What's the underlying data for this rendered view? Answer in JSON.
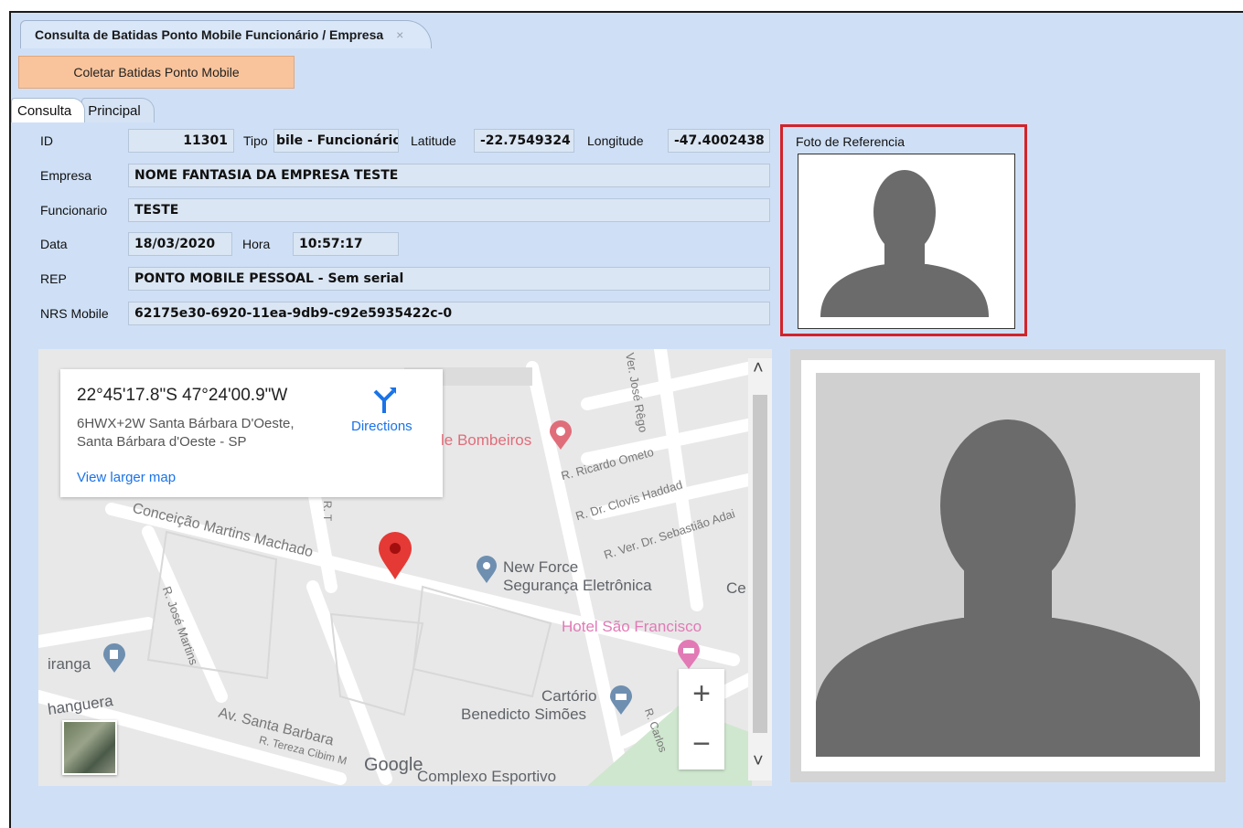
{
  "window": {
    "doc_tab": "Consulta de Batidas Ponto Mobile Funcionário / Empresa",
    "doc_tab_close": "×",
    "toolbar_button": "Coletar Batidas Ponto Mobile",
    "accent_color": "#f9c49c"
  },
  "tabs": [
    {
      "label": "Consulta",
      "active": true
    },
    {
      "label": "Principal",
      "active": false
    }
  ],
  "form": {
    "id_label": "ID",
    "id_value": "11301",
    "tipo_label": "Tipo",
    "tipo_value": "bile - Funcionário",
    "latitude_label": "Latitude",
    "latitude_value": "-22.7549324",
    "longitude_label": "Longitude",
    "longitude_value": "-47.4002438",
    "empresa_label": "Empresa",
    "empresa_value": "NOME FANTASIA DA EMPRESA TESTE",
    "funcionario_label": "Funcionario",
    "funcionario_value": "TESTE",
    "data_label": "Data",
    "data_value": "18/03/2020",
    "hora_label": "Hora",
    "hora_value": "10:57:17",
    "rep_label": "REP",
    "rep_value": "PONTO MOBILE PESSOAL - Sem serial",
    "nrs_label": "NRS Mobile",
    "nrs_value": "62175e30-6920-11ea-9db9-c92e5935422c-0"
  },
  "photo": {
    "label": "Foto de Referencia",
    "highlight_color": "#d2232a"
  },
  "map": {
    "coords": "22°45'17.8\"S 47°24'00.9\"W",
    "address_line1": "6HWX+2W Santa Bárbara D'Oeste,",
    "address_line2": "Santa Bárbara d'Oeste - SP",
    "view_larger": "View larger map",
    "directions": "Directions",
    "streets": {
      "conceicao": "Conceição Martins Machado",
      "ricardo": "R. Ricardo Ometo",
      "clovis": "R. Dr. Clovis Haddad",
      "sebastiao": "R. Ver. Dr. Sebastião Adai",
      "jose_rego": "Ver. José Rêgo",
      "jose_martins": "R. José Martins",
      "santa_barbara": "Av. Santa Barbara",
      "tereza": "R. Tereza Cibim M",
      "carlos": "R. Carlos",
      "r_t": "R. T"
    },
    "places": {
      "bombeiros": "le Bombeiros",
      "new_force_1": "New Force",
      "new_force_2": "Segurança Eletrônica",
      "hotel": "Hotel São Francisco",
      "cartorio_1": "Cartório",
      "cartorio_2": "Benedicto Simões",
      "iranga": "iranga",
      "hanguera": "hanguera",
      "complexo": "Complexo Esportivo",
      "ce": "Ce"
    },
    "zoom_in": "+",
    "zoom_out": "−",
    "google": "Google",
    "scroll_up": "˄",
    "scroll_down": "˅"
  }
}
